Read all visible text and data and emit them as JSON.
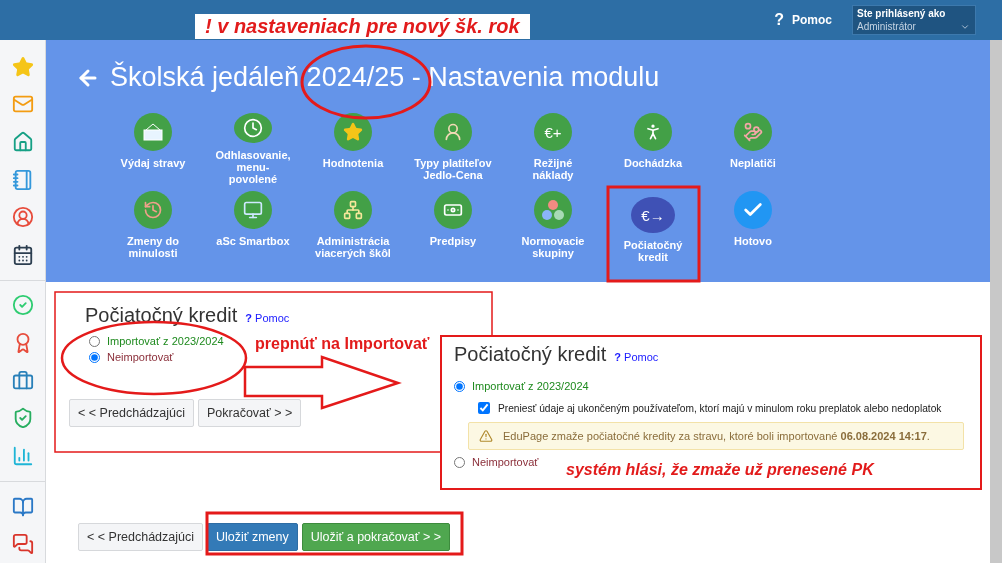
{
  "top_bar": {
    "help": {
      "glyph": "?",
      "label": "Pomoc"
    },
    "user": {
      "caption": "Ste prihlásený ako",
      "value": "Administrátor"
    }
  },
  "header": {
    "title": "Školská jedáleň 2024/25 - Nastavenia modulu"
  },
  "modules": [
    {
      "label": "Výdaj stravy",
      "kind": "module",
      "selected": false
    },
    {
      "label": "Odhlasovanie, menu-povolené",
      "kind": "module",
      "selected": false
    },
    {
      "label": "Hodnotenia",
      "kind": "module",
      "selected": false
    },
    {
      "label": "Typy platiteľov Jedlo-Cena",
      "kind": "module",
      "selected": false
    },
    {
      "label": "Režijné náklady",
      "kind": "module",
      "glyph": "€+",
      "selected": false
    },
    {
      "label": "Dochádzka",
      "kind": "module",
      "selected": false
    },
    {
      "label": "Neplatiči",
      "kind": "module",
      "selected": false
    },
    {
      "label": "Zmeny do minulosti",
      "kind": "module",
      "selected": false
    },
    {
      "label": "aSc Smartbox",
      "kind": "module",
      "selected": false
    },
    {
      "label": "Administrácia viacerých škôl",
      "kind": "module",
      "selected": false
    },
    {
      "label": "Predpisy",
      "kind": "module",
      "selected": false
    },
    {
      "label": "Normovacie skupiny",
      "kind": "module",
      "selected": false
    },
    {
      "label": "Počiatočný kredit",
      "kind": "module",
      "glyph": "€→",
      "selected": true
    },
    {
      "label": "Hotovo",
      "kind": "finish",
      "selected": false
    }
  ],
  "form": {
    "title": "Počiatočný kredit",
    "help": {
      "glyph": "?",
      "label": "Pomoc"
    },
    "options": [
      {
        "label": "Importovať z 2023/2024",
        "color": "#1e8a1e",
        "selected": false
      },
      {
        "label": "Neimportovať",
        "color": "#8b2f3a",
        "selected": true
      }
    ],
    "buttons": [
      "< < Predchádzajúci",
      "Pokračovať > >"
    ]
  },
  "inset": {
    "title": "Počiatočný kredit",
    "help": {
      "glyph": "?",
      "label": "Pomoc"
    },
    "options": [
      {
        "label": "Importovať z 2023/2024",
        "color": "#1e8a1e",
        "selected": true
      },
      {
        "label": "Neimportovať",
        "color": "#8b2f3a",
        "selected": false
      }
    ],
    "checkbox": {
      "label": "Preniesť údaje aj ukončeným používateľom, ktorí majú v minulom roku preplatok alebo nedoplatok",
      "checked": true
    },
    "warning": "EduPage zmaže počiatočné kredity za stravu, ktoré boli importované **06.08.2024 14:17**."
  },
  "bottom_buttons": [
    {
      "label": "< < Predchádzajúci",
      "kind": "default"
    },
    {
      "label": "Uložiť zmeny",
      "kind": "primary"
    },
    {
      "label": "Uložiť a pokračovať > >",
      "kind": "success"
    }
  ],
  "annotations": {
    "banner": "! v nastaveniach pre nový šk. rok",
    "switch_note": "prepnúť na  Importovať",
    "system_note": "systém hlási, že zmaže už prenesené PK"
  }
}
